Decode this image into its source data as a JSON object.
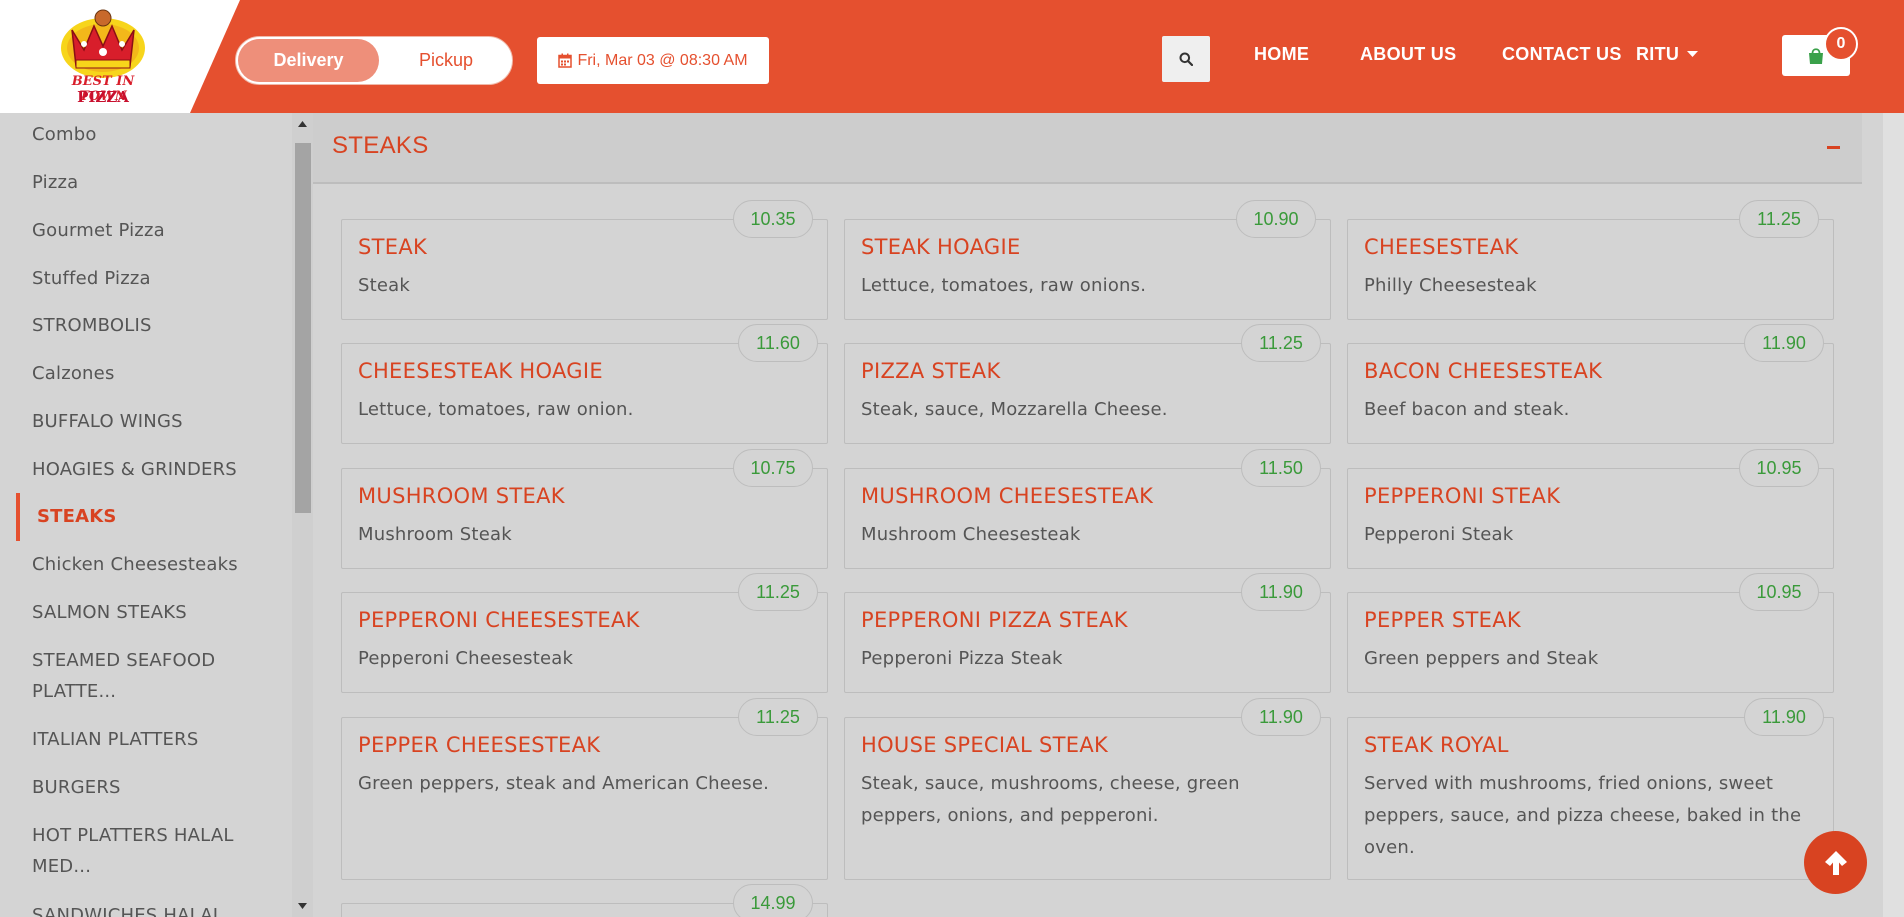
{
  "brand": {
    "logo_line1": "BEST IN TOWN",
    "logo_line2": "PIZZA"
  },
  "order_type": {
    "delivery_label": "Delivery",
    "pickup_label": "Pickup",
    "selected": "Delivery"
  },
  "schedule": {
    "date_label": "Fri, Mar 03 @ 08:30 AM"
  },
  "nav": {
    "items": [
      "HOME",
      "ABOUT US",
      "CONTACT US"
    ],
    "user_label": "RITU"
  },
  "cart": {
    "count": "0"
  },
  "colors": {
    "accent": "#e5502f",
    "title_red": "#d84321",
    "price_green": "#3a9a3a"
  },
  "sidebar": {
    "items": [
      "Combo",
      "Pizza",
      "Gourmet Pizza",
      "Stuffed Pizza",
      "STROMBOLIS",
      "Calzones",
      "BUFFALO WINGS",
      "HOAGIES & GRINDERS",
      "STEAKS",
      "Chicken Cheesesteaks",
      "SALMON STEAKS",
      "STEAMED SEAFOOD PLATTE...",
      "ITALIAN PLATTERS",
      "BURGERS",
      "HOT PLATTERS HALAL MED...",
      "SANDWICHES HALAL"
    ],
    "active": "STEAKS"
  },
  "section": {
    "title": "STEAKS"
  },
  "menu": {
    "items": [
      {
        "name": "STEAK",
        "desc": "Steak",
        "price": "10.35"
      },
      {
        "name": "STEAK HOAGIE",
        "desc": "Lettuce, tomatoes, raw onions.",
        "price": "10.90"
      },
      {
        "name": "CHEESESTEAK",
        "desc": "Philly Cheesesteak",
        "price": "11.25"
      },
      {
        "name": "CHEESESTEAK HOAGIE",
        "desc": "Lettuce, tomatoes, raw onion.",
        "price": "11.60"
      },
      {
        "name": "PIZZA STEAK",
        "desc": "Steak, sauce, Mozzarella Cheese.",
        "price": "11.25"
      },
      {
        "name": "BACON CHEESESTEAK",
        "desc": "Beef bacon and steak.",
        "price": "11.90"
      },
      {
        "name": "MUSHROOM STEAK",
        "desc": "Mushroom Steak",
        "price": "10.75"
      },
      {
        "name": "MUSHROOM CHEESESTEAK",
        "desc": "Mushroom Cheesesteak",
        "price": "11.50"
      },
      {
        "name": "PEPPERONI STEAK",
        "desc": "Pepperoni Steak",
        "price": "10.95"
      },
      {
        "name": "PEPPERONI CHEESESTEAK",
        "desc": "Pepperoni Cheesesteak",
        "price": "11.25"
      },
      {
        "name": "PEPPERONI PIZZA STEAK",
        "desc": "Pepperoni Pizza Steak",
        "price": "11.90"
      },
      {
        "name": "PEPPER STEAK",
        "desc": "Green peppers and Steak",
        "price": "10.95"
      },
      {
        "name": "PEPPER CHEESESTEAK",
        "desc": "Green peppers, steak and American Cheese.",
        "price": "11.25"
      },
      {
        "name": "HOUSE SPECIAL STEAK",
        "desc": "Steak, sauce, mushrooms, cheese, green peppers, onions, and pepperoni.",
        "price": "11.90"
      },
      {
        "name": "STEAK ROYAL",
        "desc": "Served with mushrooms, fried onions, sweet peppers, sauce, and pizza cheese, baked in the oven.",
        "price": "11.90"
      },
      {
        "name": "",
        "desc": "",
        "price": "14.99"
      }
    ]
  }
}
